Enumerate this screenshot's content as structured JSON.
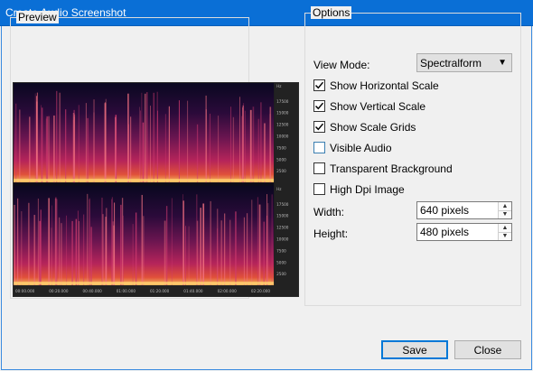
{
  "window": {
    "title": "Create Audio Screenshot"
  },
  "preview": {
    "legend": "Preview",
    "spectrogram": {
      "freq_labels": [
        "17500",
        "15000",
        "12500",
        "10000",
        "7500",
        "5000",
        "2500"
      ],
      "unit_label": "Hz",
      "time_labels": [
        "00:00.000",
        "00:20.000",
        "00:40.000",
        "01:00.000",
        "01:20.000",
        "01:40.000",
        "02:00.000",
        "02:20.000"
      ]
    }
  },
  "options": {
    "legend": "Options",
    "view_mode_label": "View Mode:",
    "view_mode_value": "Spectralform",
    "checkboxes": [
      {
        "label": "Show Horizontal Scale",
        "checked": true
      },
      {
        "label": "Show Vertical Scale",
        "checked": true
      },
      {
        "label": "Show Scale Grids",
        "checked": true
      },
      {
        "label": "Visible Audio",
        "checked": false
      },
      {
        "label": "Transparent Brackground",
        "checked": false
      },
      {
        "label": "High Dpi Image",
        "checked": false
      }
    ],
    "width_label": "Width:",
    "width_value": "640 pixels",
    "height_label": "Height:",
    "height_value": "480 pixels"
  },
  "buttons": {
    "save": "Save",
    "close": "Close"
  }
}
